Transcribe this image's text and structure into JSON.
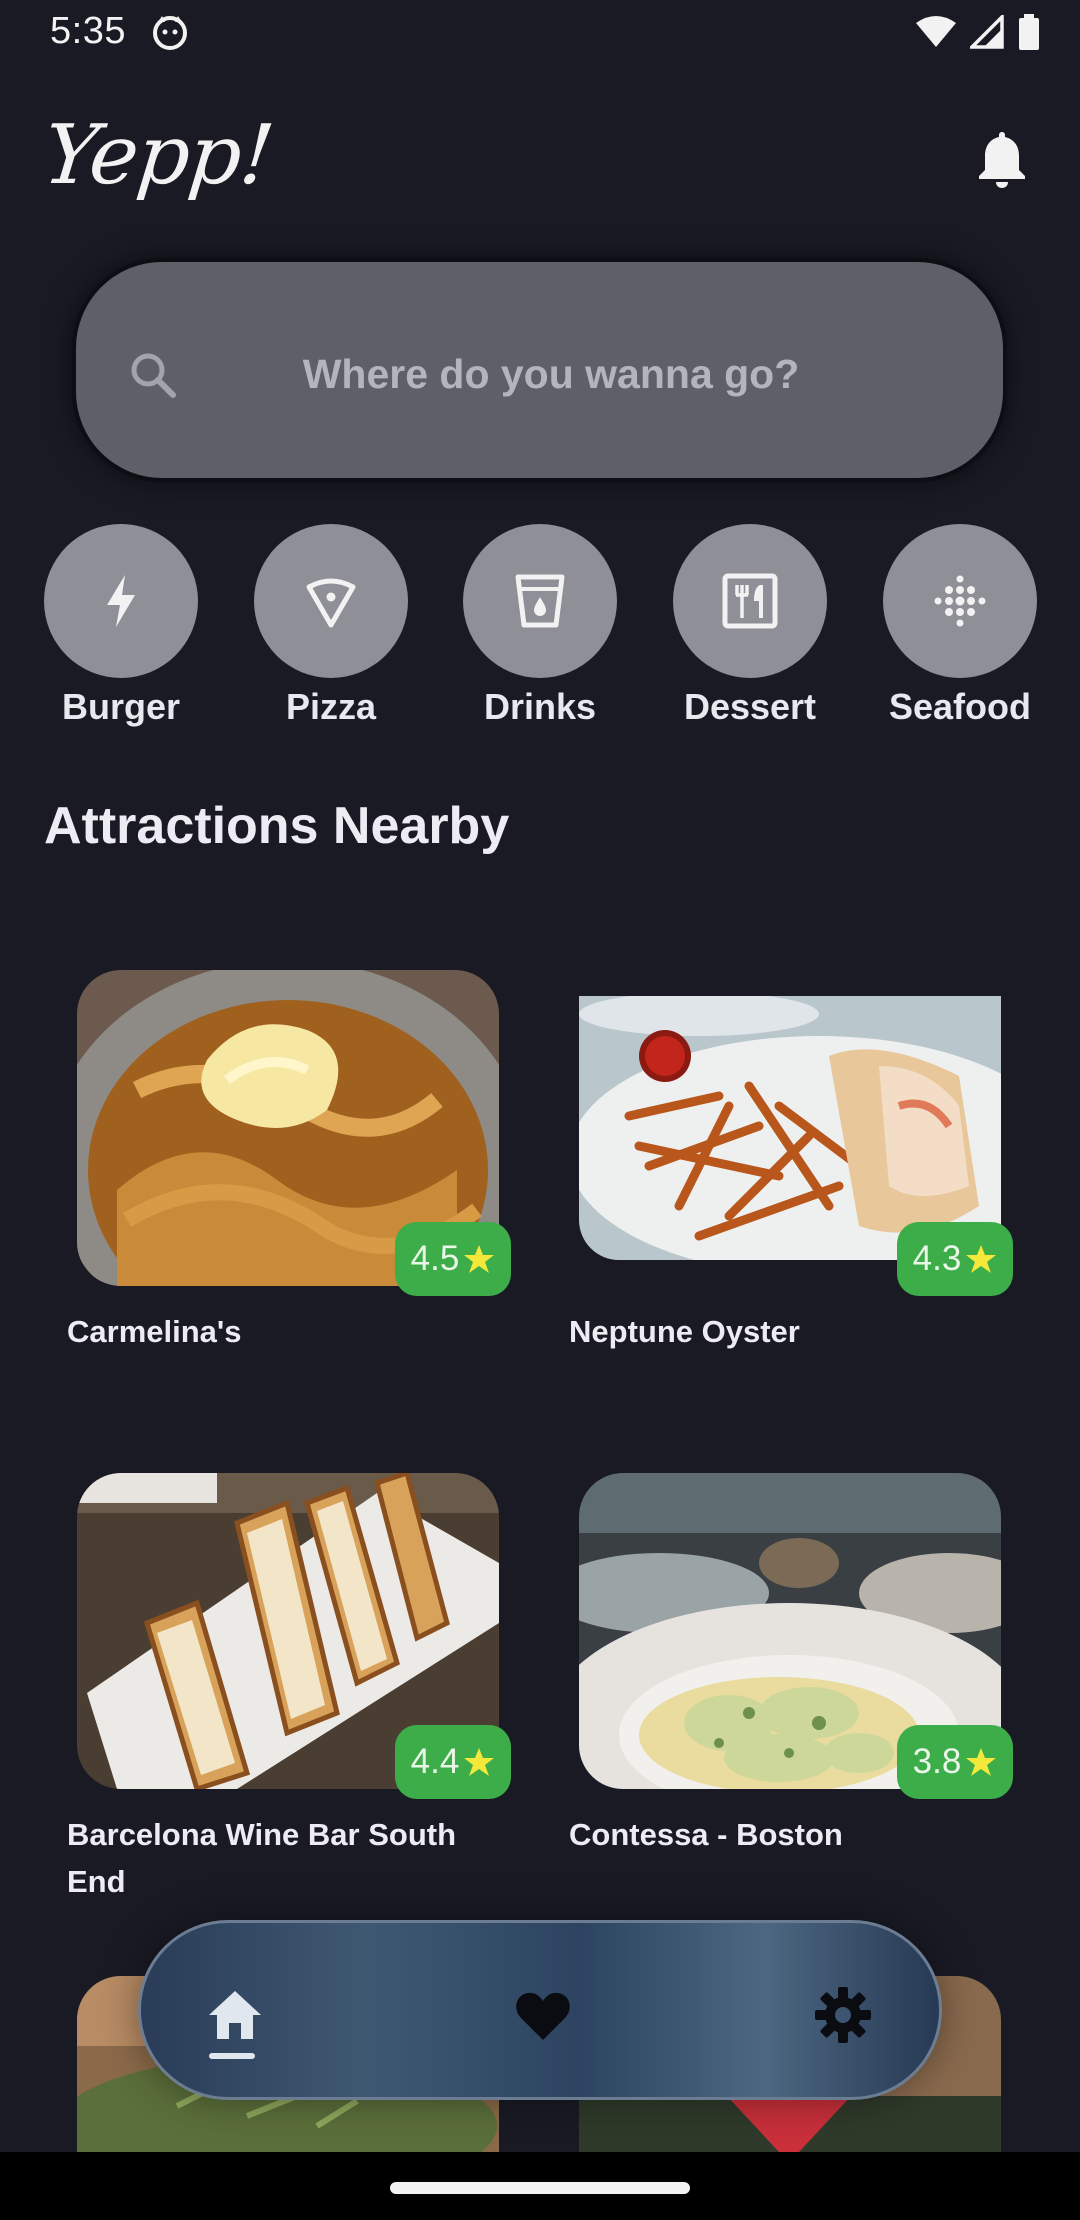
{
  "status_bar": {
    "time": "5:35"
  },
  "header": {
    "logo": "Yepp!"
  },
  "search": {
    "placeholder": "Where do you wanna go?"
  },
  "categories": [
    {
      "label": "Burger",
      "icon": "bolt-icon"
    },
    {
      "label": "Pizza",
      "icon": "pizza-slice-icon"
    },
    {
      "label": "Drinks",
      "icon": "cup-icon"
    },
    {
      "label": "Dessert",
      "icon": "restaurant-menu-icon"
    },
    {
      "label": "Seafood",
      "icon": "dots-grid-icon"
    }
  ],
  "section": {
    "title": "Attractions Nearby"
  },
  "places": [
    {
      "name": "Carmelina's",
      "rating": "4.5"
    },
    {
      "name": "Neptune Oyster",
      "rating": "4.3"
    },
    {
      "name": "Barcelona Wine Bar South End",
      "rating": "4.4"
    },
    {
      "name": "Contessa - Boston",
      "rating": "3.8"
    }
  ],
  "bottom_nav": {
    "items": [
      "home-icon",
      "heart-icon",
      "gear-icon"
    ],
    "active": "home-icon"
  },
  "colors": {
    "background": "#191a24",
    "rating_badge": "#3cad48",
    "star": "#f4e93a",
    "category_circle": "#8f8f97"
  }
}
